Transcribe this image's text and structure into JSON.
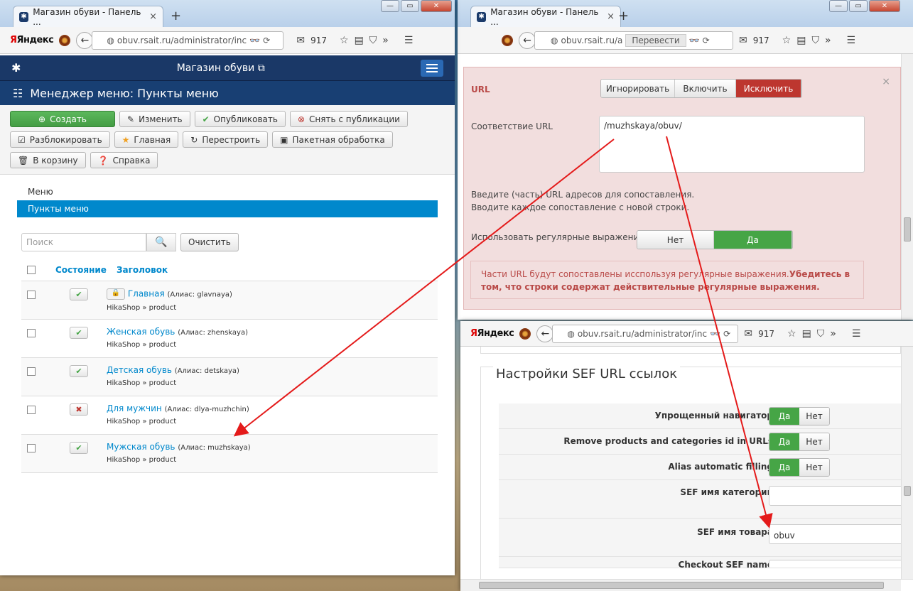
{
  "left_window": {
    "tab_title": "Магазин обуви - Панель ...",
    "yandex": "Яндекс",
    "url": "obuv.rsait.ru/administrator/inc",
    "mail_count": "917",
    "site_title": "Магазин обуви",
    "page_header": "Менеджер меню: Пункты меню",
    "toolbar": {
      "create": "Создать",
      "edit": "Изменить",
      "publish": "Опубликовать",
      "unpublish": "Снять с публикации",
      "unlock": "Разблокировать",
      "home": "Главная",
      "rebuild": "Перестроить",
      "batch": "Пакетная обработка",
      "trash": "В корзину",
      "help": "Справка"
    },
    "submenu": [
      "Меню",
      "Пункты меню"
    ],
    "search_placeholder": "Поиск",
    "clear_label": "Очистить",
    "columns": {
      "state": "Состояние",
      "title": "Заголовок"
    },
    "rows": [
      {
        "title": "Главная",
        "alias": "(Алиас: glavnaya)",
        "path": "HikaShop » product",
        "state": "published",
        "locked": true
      },
      {
        "title": "Женская обувь",
        "alias": "(Алиас: zhenskaya)",
        "path": "HikaShop » product",
        "state": "published",
        "locked": false
      },
      {
        "title": "Детская обувь",
        "alias": "(Алиас: detskaya)",
        "path": "HikaShop » product",
        "state": "published",
        "locked": false
      },
      {
        "title": "Для мужчин",
        "alias": "(Алиас: dlya-muzhchin)",
        "path": "HikaShop » product",
        "state": "unpublished",
        "locked": false
      },
      {
        "title": "Мужская обувь",
        "alias": "(Алиас: muzhskaya)",
        "path": "HikaShop » product",
        "state": "published",
        "locked": false
      }
    ]
  },
  "right_top_window": {
    "tab_title": "Магазин обуви - Панель ...",
    "yandex": "Яндекс",
    "url": "obuv.rsait.ru/a",
    "translate": "Перевести",
    "mail_count": "917",
    "url_label": "URL",
    "ignore": "Игнорировать",
    "include": "Включить",
    "exclude": "Исключить",
    "match_label": "Соответствие URL",
    "match_value": "/muzhskaya/obuv/",
    "hint1": "Введите (часть) URL адресов для сопоставления.",
    "hint2": "Вводите каждое сопоставление с новой строки.",
    "regex_label": "Использовать регулярные выражения",
    "no": "Нет",
    "yes": "Да",
    "alert_text": "Части URL будут сопоставлены исспользуя регулярные выражения.",
    "alert_bold": "Убедитесь в том, что строки содержат действительные регулярные выражения."
  },
  "right_bottom_window": {
    "yandex": "Яндекс",
    "url": "obuv.rsait.ru/administrator/inc",
    "mail_count": "917",
    "legend": "Настройки SEF URL ссылок",
    "rows": [
      {
        "label": "Упрощенный навигатор",
        "yes": "Да",
        "no": "Нет"
      },
      {
        "label": "Remove products and categories id in URLs",
        "yes": "Да",
        "no": "Нет"
      },
      {
        "label": "Alias automatic filling",
        "yes": "Да",
        "no": "Нет"
      }
    ],
    "cat_label": "SEF имя категории",
    "cat_value": "",
    "prod_label": "SEF имя товара",
    "prod_value": "obuv",
    "checkout_label": "Checkout SEF name"
  }
}
